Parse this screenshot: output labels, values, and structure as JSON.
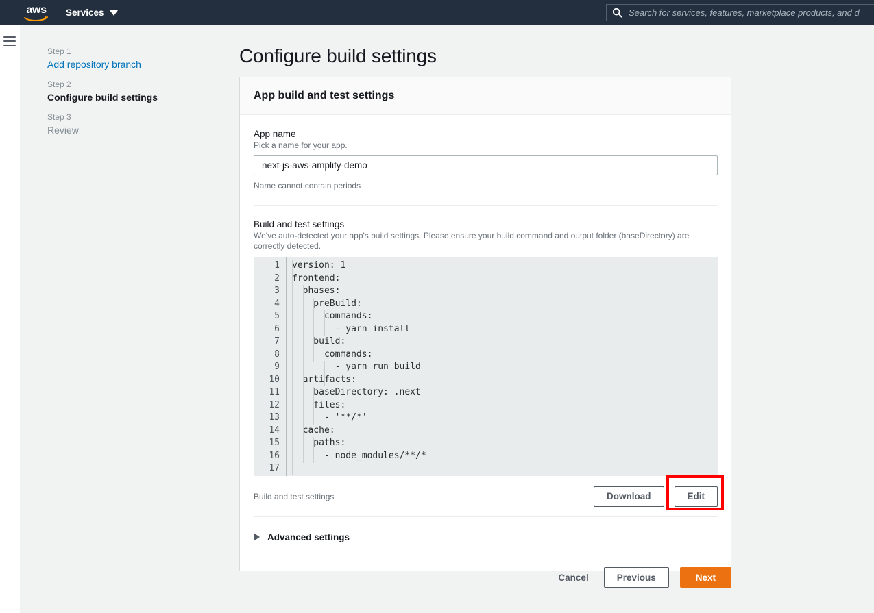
{
  "nav": {
    "logo_text": "aws",
    "logo_icon": "aws-smile-logo",
    "services_label": "Services",
    "services_caret_icon": "chevron-down-icon",
    "search_icon": "search-icon",
    "search_placeholder": "Search for services, features, marketplace products, and d",
    "search_value": ""
  },
  "rail": {
    "menu_icon": "hamburger-menu-icon"
  },
  "wizard": {
    "steps": [
      {
        "number": "Step 1",
        "title": "Add repository branch",
        "state": "link"
      },
      {
        "number": "Step 2",
        "title": "Configure build settings",
        "state": "current"
      },
      {
        "number": "Step 3",
        "title": "Review",
        "state": "upcoming"
      }
    ]
  },
  "page": {
    "title": "Configure build settings"
  },
  "card": {
    "header_title": "App build and test settings",
    "app_name": {
      "label": "App name",
      "description": "Pick a name for your app.",
      "value": "next-js-aws-amplify-demo",
      "placeholder": "",
      "hint": "Name cannot contain periods"
    },
    "build_settings": {
      "label": "Build and test settings",
      "description": "We've auto-detected your app's build settings. Please ensure your build command and output folder (baseDirectory) are correctly detected.",
      "code_lines": [
        "version: 1",
        "frontend:",
        "  phases:",
        "    preBuild:",
        "      commands:",
        "        - yarn install",
        "    build:",
        "      commands:",
        "        - yarn run build",
        "  artifacts:",
        "    baseDirectory: .next",
        "    files:",
        "      - '**/*'",
        "  cache:",
        "    paths:",
        "      - node_modules/**/*",
        ""
      ],
      "line_numbers": [
        "1",
        "2",
        "3",
        "4",
        "5",
        "6",
        "7",
        "8",
        "9",
        "10",
        "11",
        "12",
        "13",
        "14",
        "15",
        "16",
        "17"
      ],
      "footer_label": "Build and test settings",
      "download_label": "Download",
      "edit_label": "Edit"
    },
    "advanced": {
      "caret_icon": "chevron-right-icon",
      "label": "Advanced settings"
    }
  },
  "footer": {
    "cancel_label": "Cancel",
    "previous_label": "Previous",
    "next_label": "Next"
  },
  "annotation": {
    "highlight_target": "edit-button",
    "highlight_color": "#ff0000"
  },
  "colors": {
    "nav_bg": "#232f3e",
    "page_bg": "#f1f3f3",
    "accent_orange": "#ec7211",
    "link_blue": "#0073bb",
    "editor_bg": "#e8ecec"
  }
}
